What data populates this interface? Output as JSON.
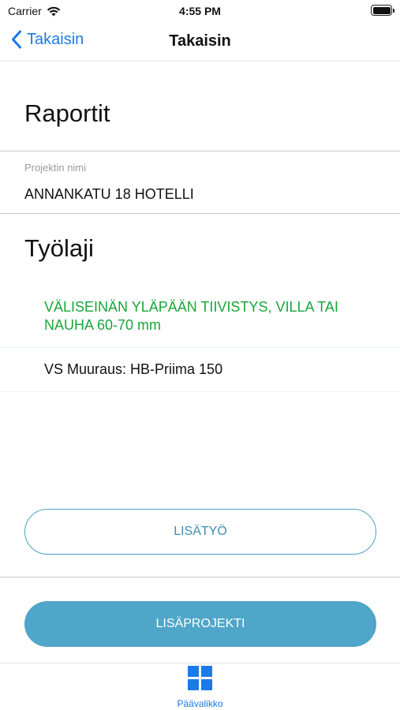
{
  "status_bar": {
    "carrier": "Carrier",
    "time": "4:55 PM",
    "icons": [
      "wifi-icon",
      "battery-icon"
    ]
  },
  "nav": {
    "back_label": "Takaisin",
    "back_icon": "chevron-left-icon",
    "title": "Takaisin",
    "accent_color": "#1a7ae8"
  },
  "reports": {
    "heading": "Raportit"
  },
  "project_field": {
    "label": "Projektin nimi",
    "value": "ANNANKATU 18 HOTELLI"
  },
  "worktype": {
    "heading": "Työlaji",
    "items": [
      {
        "label": "VÄLISEINÄN YLÄPÄÄN TIIVISTYS, VILLA TAI NAUHA 60-70 mm",
        "color": "#19a63a",
        "selected": true
      },
      {
        "label": "VS Muuraus: HB-Priima 150",
        "color": "#111111",
        "selected": false
      }
    ]
  },
  "buttons": {
    "extra_work_label": "LISÄTYÖ",
    "extra_project_label": "LISÄPROJEKTI",
    "button_color": "#4fa6c8"
  },
  "tab_bar": {
    "items": [
      {
        "label": "Päävalikko",
        "icon": "grid-icon",
        "active": true
      }
    ]
  }
}
